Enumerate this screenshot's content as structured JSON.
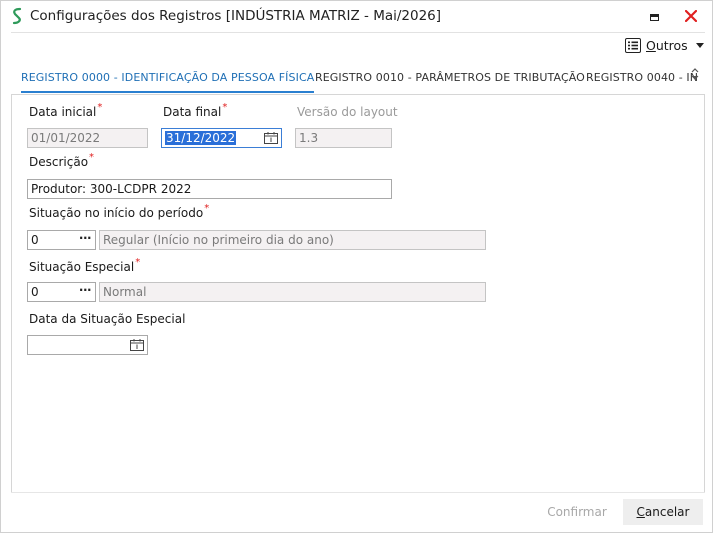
{
  "window": {
    "title": "Configurações dos Registros [INDÚSTRIA MATRIZ - Mai/2026]"
  },
  "toolbar": {
    "outros_first": "O",
    "outros_rest": "utros"
  },
  "tabs": [
    {
      "label": "REGISTRO 0000 - IDENTIFICAÇÃO DA PESSOA FÍSICA",
      "active": true
    },
    {
      "label": "REGISTRO 0010 - PARÂMETROS DE TRIBUTAÇÃO",
      "active": false
    },
    {
      "label": "REGISTRO 0040 - IN",
      "active": false
    }
  ],
  "form": {
    "data_inicial": {
      "label": "Data inicial",
      "value": "01/01/2022"
    },
    "data_final": {
      "label": "Data final",
      "value": "31/12/2022"
    },
    "versao_layout": {
      "label": "Versão do layout",
      "value": "1.3"
    },
    "descricao": {
      "label": "Descrição",
      "value": "Produtor: 300-LCDPR 2022"
    },
    "situacao_inicio": {
      "label": "Situação no início do período",
      "code": "0",
      "description": "Regular (Início no primeiro dia do ano)"
    },
    "situacao_especial": {
      "label": "Situação Especial",
      "code": "0",
      "description": "Normal"
    },
    "data_situacao_especial": {
      "label": "Data da Situação Especial",
      "value": ""
    },
    "required_mark": "*",
    "lookup_button": "···"
  },
  "footer": {
    "confirm_label": "Confirmar",
    "cancel_first": "C",
    "cancel_rest": "ancelar"
  },
  "colors": {
    "accent": "#2a7fd0",
    "required": "#e02020",
    "selection": "#2a6fd8",
    "close_icon": "#e02020",
    "app_icon": "#2e9a5a"
  }
}
